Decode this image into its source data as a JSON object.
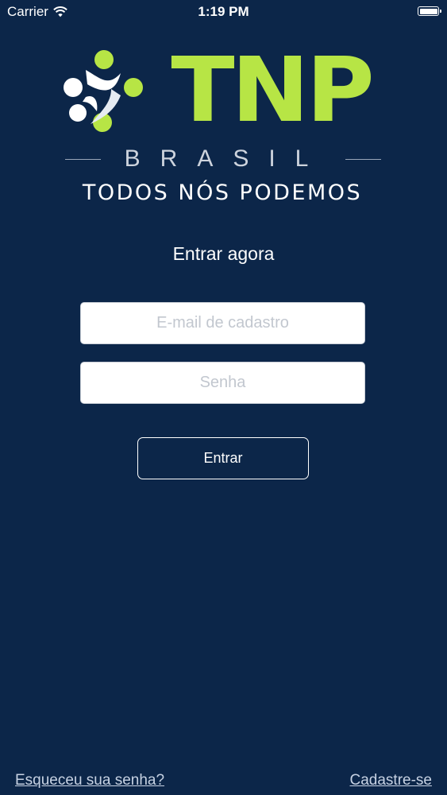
{
  "status_bar": {
    "carrier": "Carrier",
    "time": "1:19 PM",
    "wifi_icon": "wifi-icon",
    "battery_icon": "battery-icon"
  },
  "logo": {
    "wordmark": "TNP",
    "country": "BRASIL",
    "tagline": "TODOS NÓS PODEMOS",
    "accent_color": "#b7e545",
    "emblem_icon": "people-circle-emblem-icon"
  },
  "login": {
    "heading": "Entrar agora",
    "email_placeholder": "E-mail de cadastro",
    "email_value": "",
    "password_placeholder": "Senha",
    "password_value": "",
    "submit_label": "Entrar"
  },
  "footer": {
    "forgot_password": "Esqueceu sua senha?",
    "signup": "Cadastre-se"
  },
  "colors": {
    "background": "#0c2649",
    "accent": "#b7e545",
    "link": "#c7d2e3"
  }
}
